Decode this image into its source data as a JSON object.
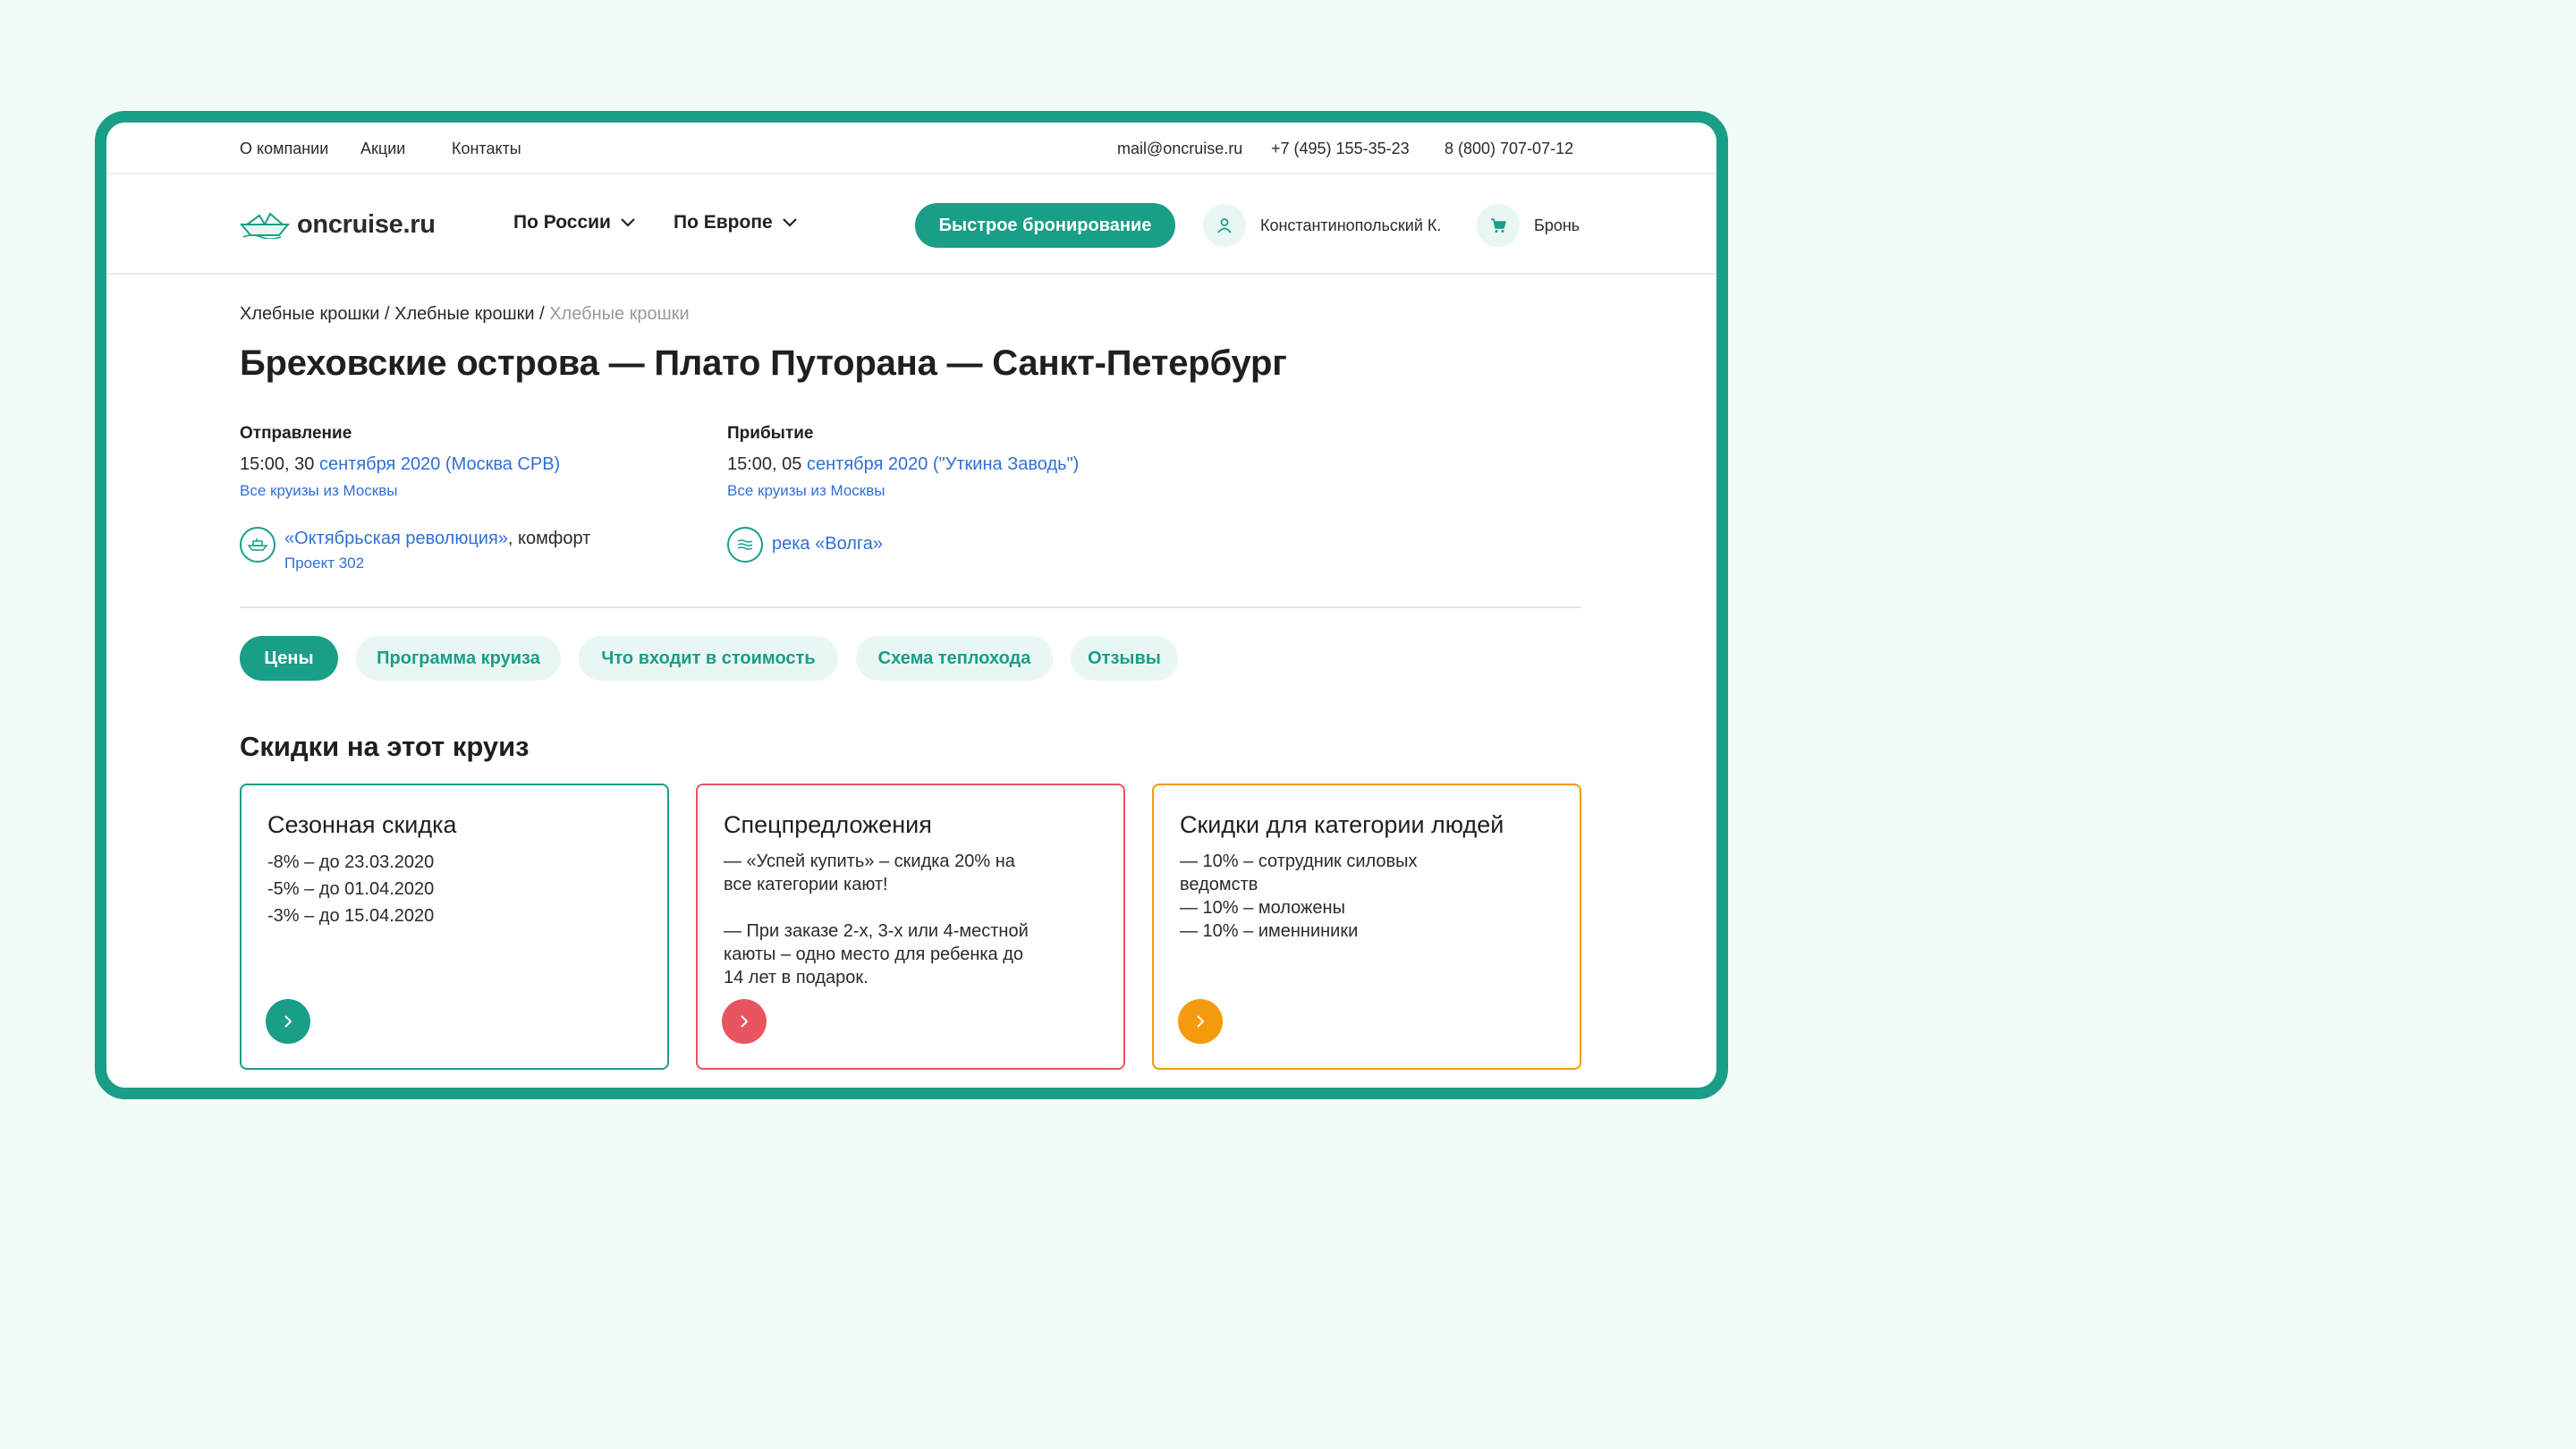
{
  "topbar": {
    "links": [
      "О компании",
      "Акции",
      "Контакты"
    ],
    "email": "mail@oncruise.ru",
    "phone1": "+7 (495) 155-35-23",
    "phone2": "8 (800) 707-07-12"
  },
  "header": {
    "logo_text": "oncruise.ru",
    "logo_icon": "paper-boat-icon",
    "nav": [
      "По России",
      "По Европе"
    ],
    "quick_booking": "Быстрое бронирование",
    "user_name": "Константинопольский К.",
    "user_icon": "user-icon",
    "cart_label": "Бронь",
    "cart_icon": "cart-icon"
  },
  "breadcrumbs": [
    "Хлебные крошки",
    "Хлебные крошки",
    "Хлебные крошки"
  ],
  "page_title": "Бреховские острова — Плато Путорана — Санкт-Петербург",
  "departure": {
    "label": "Отправление",
    "time": "15:00, 30",
    "link": "сентября 2020 (Москва СРВ)",
    "all_link": "Все круизы из Москвы"
  },
  "arrival": {
    "label": "Прибытие",
    "time": "15:00, 05",
    "link": "сентября 2020 (\"Уткина Заводь\")",
    "all_link": "Все круизы из Москвы"
  },
  "ship": {
    "icon": "ship-icon",
    "name_link": "«Октябрьская революция»",
    "suffix": ", комфорт",
    "project": "Проект 302"
  },
  "river": {
    "icon": "waves-icon",
    "link": "река «Волга»"
  },
  "tabs": [
    {
      "label": "Цены",
      "active": true
    },
    {
      "label": "Программа круиза",
      "active": false
    },
    {
      "label": "Что входит в стоимость",
      "active": false
    },
    {
      "label": "Схема теплохода",
      "active": false
    },
    {
      "label": "Отзывы",
      "active": false
    }
  ],
  "discounts": {
    "title": "Скидки на этот круиз",
    "cards": [
      {
        "title": "Сезонная скидка",
        "lines": [
          "-8% – до 23.03.2020",
          "-5% – до 01.04.2020",
          "-3% – до 15.04.2020"
        ],
        "color": "#1a9e87"
      },
      {
        "title": "Спецпредложения",
        "lines": [
          "— «Успей купить» – скидка 20% на",
          "все категории кают!",
          "",
          "— При заказе 2-х, 3-х или 4-местной",
          "каюты – одно место для ребенка до",
          "14 лет в подарок."
        ],
        "color": "#e85560"
      },
      {
        "title": "Скидки для категории людей",
        "lines": [
          "—  10% – сотрудник силовых",
          "ведомств",
          "— 10% – моложены",
          "— 10% – именниники"
        ],
        "color": "#f59a0c"
      }
    ]
  },
  "colors": {
    "accent": "#1a9e87",
    "link": "#2f6fd6",
    "background": "#f0fbf8"
  }
}
